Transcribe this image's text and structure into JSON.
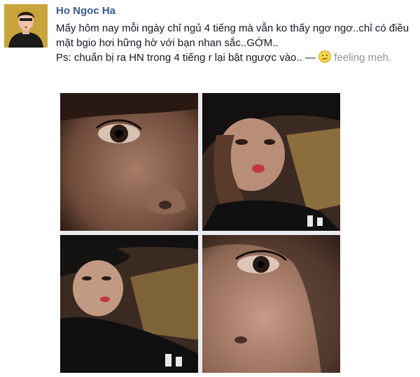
{
  "post": {
    "author": "Ho Ngoc Ha",
    "line1": "Mấy hôm nay mỗi ngày chỉ ngủ 4 tiếng mà vẫn ko thấy ngơ ngơ..chỉ có điều mặt bgio hơi hững hờ với bạn nhan sắc..GỚM..",
    "line2": "Ps: chuẩn bị ra HN trong 4 tiếng r lại bật ngược vào.. —",
    "feeling": "feeling meh."
  },
  "icons": {
    "avatar": "profile-avatar",
    "feeling": "meh-face-icon"
  },
  "colors": {
    "author_link": "#3b5998",
    "text": "#141823",
    "feeling_text": "#90949c"
  }
}
